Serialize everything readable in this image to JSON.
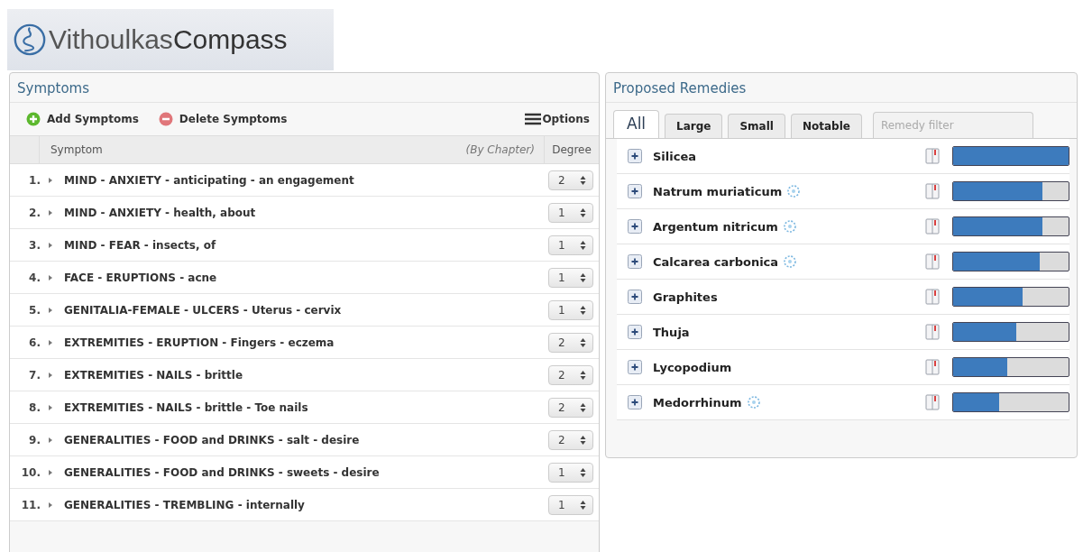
{
  "logo": {
    "first": "Vithoulkas",
    "second": "Compass"
  },
  "symptoms": {
    "title": "Symptoms",
    "toolbar": {
      "add": "Add Symptoms",
      "delete": "Delete Symptoms",
      "options": "Options"
    },
    "columns": {
      "symptom": "Symptom",
      "by_chapter": "(By Chapter)",
      "degree": "Degree"
    },
    "rows": [
      {
        "number": "1.",
        "text": "MIND - ANXIETY - anticipating - an engagement",
        "degree": "2"
      },
      {
        "number": "2.",
        "text": "MIND - ANXIETY - health, about",
        "degree": "1"
      },
      {
        "number": "3.",
        "text": "MIND - FEAR - insects, of",
        "degree": "1"
      },
      {
        "number": "4.",
        "text": "FACE - ERUPTIONS - acne",
        "degree": "1"
      },
      {
        "number": "5.",
        "text": "GENITALIA-FEMALE - ULCERS - Uterus - cervix",
        "degree": "1"
      },
      {
        "number": "6.",
        "text": "EXTREMITIES - ERUPTION - Fingers - eczema",
        "degree": "2"
      },
      {
        "number": "7.",
        "text": "EXTREMITIES - NAILS - brittle",
        "degree": "2"
      },
      {
        "number": "8.",
        "text": "EXTREMITIES - NAILS - brittle - Toe nails",
        "degree": "2"
      },
      {
        "number": "9.",
        "text": "GENERALITIES - FOOD and DRINKS - salt - desire",
        "degree": "2"
      },
      {
        "number": "10.",
        "text": "GENERALITIES - FOOD and DRINKS - sweets - desire",
        "degree": "1"
      },
      {
        "number": "11.",
        "text": "GENERALITIES - TREMBLING - internally",
        "degree": "1"
      }
    ]
  },
  "remedies": {
    "title": "Proposed Remedies",
    "tabs": [
      {
        "label": "All",
        "selected": true
      },
      {
        "label": "Large",
        "selected": false
      },
      {
        "label": "Small",
        "selected": false
      },
      {
        "label": "Notable",
        "selected": false
      }
    ],
    "filter": {
      "placeholder": "Remedy filter"
    },
    "items": [
      {
        "name": "Silicea",
        "marked": false,
        "level": 1.0
      },
      {
        "name": "Natrum muriaticum",
        "marked": true,
        "level": 0.77
      },
      {
        "name": "Argentum nitricum",
        "marked": true,
        "level": 0.77
      },
      {
        "name": "Calcarea carbonica",
        "marked": true,
        "level": 0.75
      },
      {
        "name": "Graphites",
        "marked": false,
        "level": 0.6
      },
      {
        "name": "Thuja",
        "marked": false,
        "level": 0.55
      },
      {
        "name": "Lycopodium",
        "marked": false,
        "level": 0.47
      },
      {
        "name": "Medorrhinum",
        "marked": true,
        "level": 0.4
      }
    ]
  }
}
